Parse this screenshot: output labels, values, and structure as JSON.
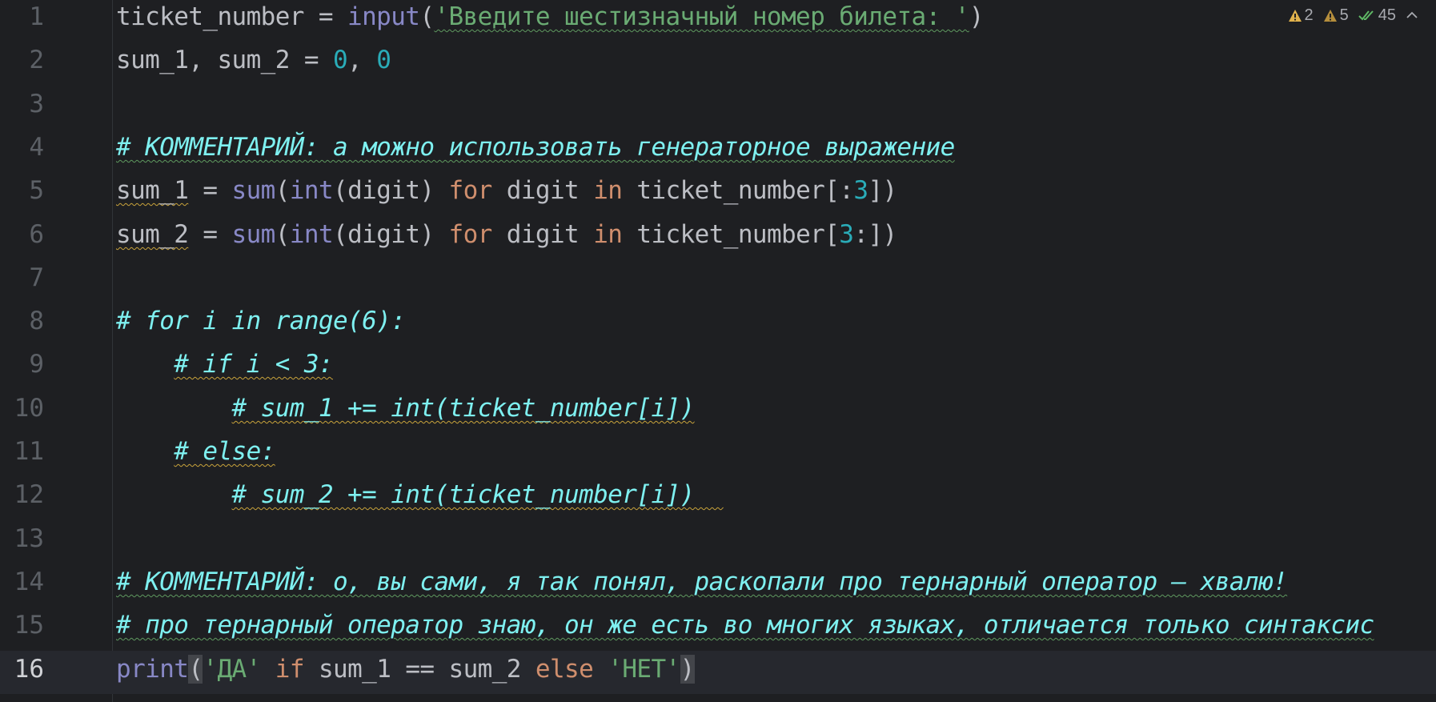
{
  "indicators": {
    "warnings_strong": "2",
    "warnings_weak": "5",
    "ok_count": "45",
    "icons": [
      "warning-triangle-icon",
      "warning-triangle-icon",
      "double-check-icon",
      "chevron-up-icon"
    ]
  },
  "colors": {
    "background": "#1e1f22",
    "current_line": "#26282e",
    "keyword": "#cf8e6d",
    "builtin": "#8888c6",
    "number": "#2aacb8",
    "string": "#6aab73",
    "comment": "#7ef0f0",
    "warning": "#c9a33b"
  },
  "current_line": 16,
  "lines": [
    {
      "n": "1",
      "tokens": [
        {
          "t": "ticket_number = ",
          "c": ""
        },
        {
          "t": "input",
          "c": "fn"
        },
        {
          "t": "(",
          "c": ""
        },
        {
          "t": "'Введите шестизначный номер билета: '",
          "c": "str typo-u"
        },
        {
          "t": ")",
          "c": ""
        }
      ]
    },
    {
      "n": "2",
      "tokens": [
        {
          "t": "sum_1, sum_2 = ",
          "c": ""
        },
        {
          "t": "0",
          "c": "num"
        },
        {
          "t": ", ",
          "c": ""
        },
        {
          "t": "0",
          "c": "num"
        }
      ]
    },
    {
      "n": "3",
      "tokens": []
    },
    {
      "n": "4",
      "tokens": [
        {
          "t": "# КОММЕНТАРИЙ: а можно использовать генераторное выражение",
          "c": "cm typo-u"
        }
      ]
    },
    {
      "n": "5",
      "tokens": [
        {
          "t": "sum_1",
          "c": "warn-u"
        },
        {
          "t": " = ",
          "c": ""
        },
        {
          "t": "sum",
          "c": "fn"
        },
        {
          "t": "(",
          "c": ""
        },
        {
          "t": "int",
          "c": "fn"
        },
        {
          "t": "(digit) ",
          "c": ""
        },
        {
          "t": "for",
          "c": "kw"
        },
        {
          "t": " digit ",
          "c": ""
        },
        {
          "t": "in",
          "c": "kw"
        },
        {
          "t": " ticket_number[:",
          "c": ""
        },
        {
          "t": "3",
          "c": "num"
        },
        {
          "t": "])",
          "c": ""
        }
      ]
    },
    {
      "n": "6",
      "tokens": [
        {
          "t": "sum_2",
          "c": "warn-u"
        },
        {
          "t": " = ",
          "c": ""
        },
        {
          "t": "sum",
          "c": "fn"
        },
        {
          "t": "(",
          "c": ""
        },
        {
          "t": "int",
          "c": "fn"
        },
        {
          "t": "(digit) ",
          "c": ""
        },
        {
          "t": "for",
          "c": "kw"
        },
        {
          "t": " digit ",
          "c": ""
        },
        {
          "t": "in",
          "c": "kw"
        },
        {
          "t": " ticket_number[",
          "c": ""
        },
        {
          "t": "3",
          "c": "num"
        },
        {
          "t": ":])",
          "c": ""
        }
      ]
    },
    {
      "n": "7",
      "tokens": []
    },
    {
      "n": "8",
      "tokens": [
        {
          "t": "# for i in range(6):",
          "c": "cm"
        }
      ]
    },
    {
      "n": "9",
      "tokens": [
        {
          "t": "    ",
          "c": ""
        },
        {
          "t": "# if i < 3:",
          "c": "cm warn-u"
        }
      ]
    },
    {
      "n": "10",
      "tokens": [
        {
          "t": "        ",
          "c": ""
        },
        {
          "t": "# sum_1 += int(ticket_number[i])",
          "c": "cm warn-u"
        }
      ]
    },
    {
      "n": "11",
      "tokens": [
        {
          "t": "    ",
          "c": ""
        },
        {
          "t": "# else:",
          "c": "cm warn-u"
        }
      ]
    },
    {
      "n": "12",
      "tokens": [
        {
          "t": "        ",
          "c": ""
        },
        {
          "t": "# sum_2 += int(ticket_number[i])  ",
          "c": "cm warn-u"
        }
      ]
    },
    {
      "n": "13",
      "tokens": []
    },
    {
      "n": "14",
      "tokens": [
        {
          "t": "# КОММЕНТАРИЙ: о, вы сами, я так понял, раскопали про тернарный оператор — хвалю!",
          "c": "cm typo-u"
        }
      ]
    },
    {
      "n": "15",
      "tokens": [
        {
          "t": "# про тернарный оператор знаю, он же есть во многих языках, отличается только синтаксис",
          "c": "cm typo-u"
        }
      ]
    },
    {
      "n": "16",
      "tokens": [
        {
          "t": "print",
          "c": "fn"
        },
        {
          "t": "(",
          "c": "brace-hl"
        },
        {
          "t": "'ДА'",
          "c": "str"
        },
        {
          "t": " ",
          "c": ""
        },
        {
          "t": "if",
          "c": "kw"
        },
        {
          "t": " sum_1 == sum_2 ",
          "c": ""
        },
        {
          "t": "else",
          "c": "kw"
        },
        {
          "t": " ",
          "c": ""
        },
        {
          "t": "'НЕТ'",
          "c": "str"
        },
        {
          "t": ")",
          "c": "brace-hl"
        }
      ]
    }
  ]
}
